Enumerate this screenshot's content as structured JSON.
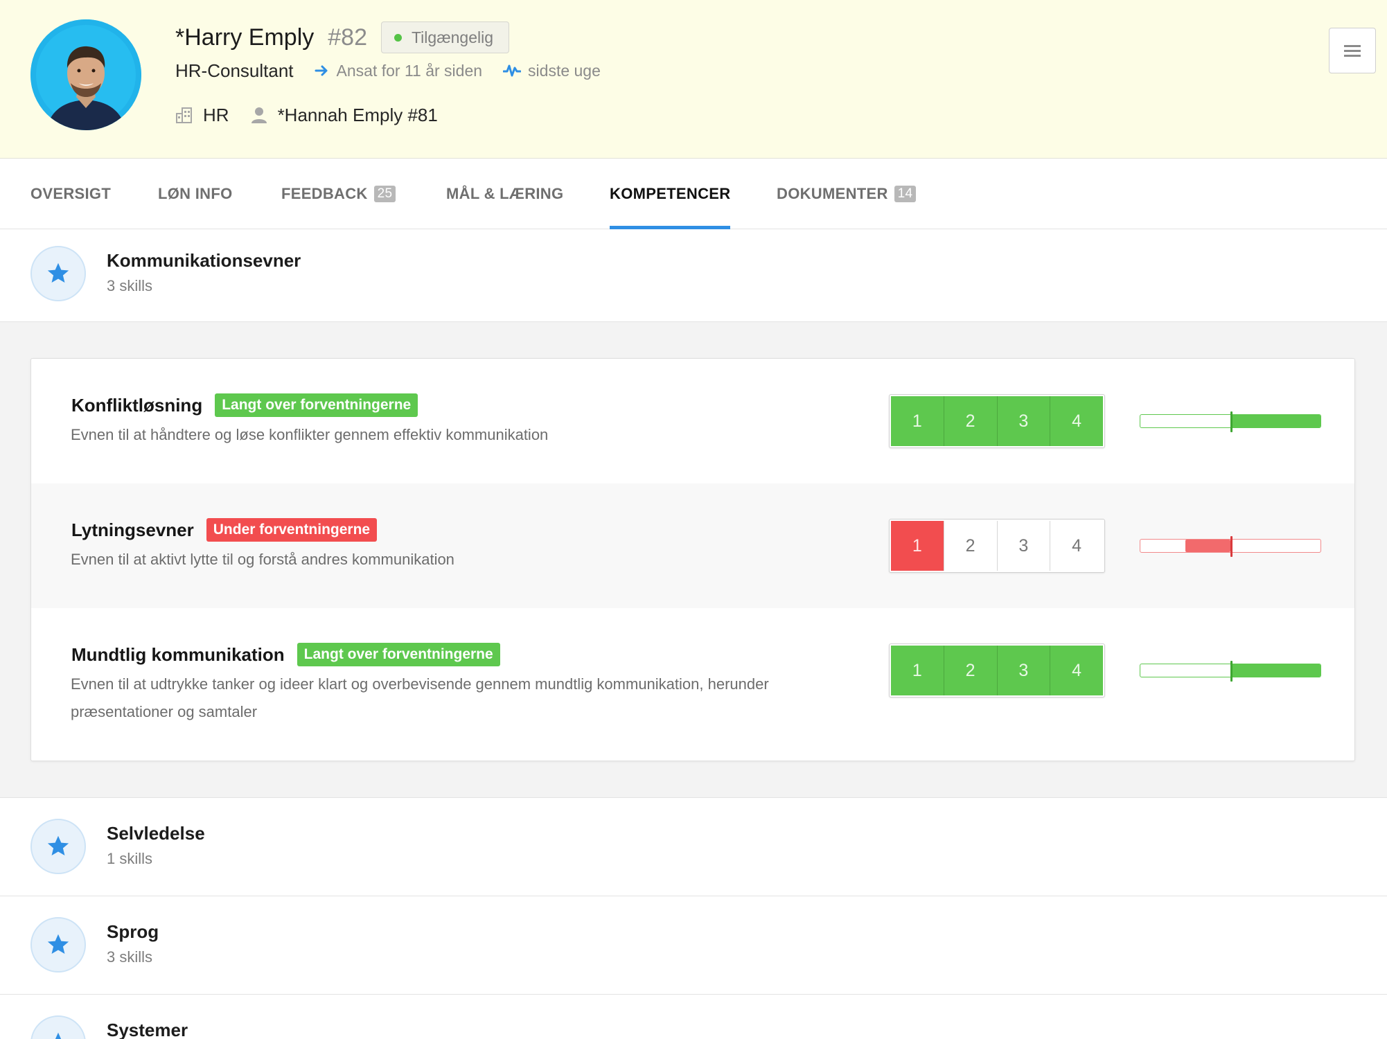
{
  "employee": {
    "name": "*Harry Emply",
    "number": "#82",
    "status": "Tilgængelig",
    "job_title": "HR-Consultant",
    "employed": "Ansat for 11 år siden",
    "activity": "sidste uge",
    "department": "HR",
    "manager": "*Hannah Emply #81"
  },
  "tabs": [
    {
      "label": "OVERSIGT"
    },
    {
      "label": "LØN INFO"
    },
    {
      "label": "FEEDBACK",
      "count": "25"
    },
    {
      "label": "MÅL & LÆRING"
    },
    {
      "label": "KOMPETENCER"
    },
    {
      "label": "DOKUMENTER",
      "count": "14"
    }
  ],
  "active_tab": "KOMPETENCER",
  "categories": [
    {
      "title": "Kommunikationsevner",
      "count": "3 skills",
      "expanded": true,
      "skills": [
        {
          "name": "Konfliktløsning",
          "badge": "Langt over forventningerne",
          "status": "green",
          "desc": "Evnen til at håndtere og løse konflikter gennem effektiv kommunikation",
          "level": 4,
          "scale": [
            "1",
            "2",
            "3",
            "4"
          ],
          "expected_level": 2
        },
        {
          "name": "Lytningsevner",
          "badge": "Under forventningerne",
          "status": "red",
          "desc": "Evnen til at aktivt lytte til og forstå andres kommunikation",
          "level": 1,
          "scale": [
            "1",
            "2",
            "3",
            "4"
          ],
          "expected_level": 2
        },
        {
          "name": "Mundtlig kommunikation",
          "badge": "Langt over forventningerne",
          "status": "green",
          "desc": "Evnen til at udtrykke tanker og ideer klart og overbevisende gennem mundtlig kommunikation, herunder præsentationer og samtaler",
          "level": 4,
          "scale": [
            "1",
            "2",
            "3",
            "4"
          ],
          "expected_level": 2
        }
      ]
    },
    {
      "title": "Selvledelse",
      "count": "1 skills",
      "expanded": false
    },
    {
      "title": "Sprog",
      "count": "3 skills",
      "expanded": false
    },
    {
      "title": "Systemer",
      "count": "",
      "expanded": false
    }
  ],
  "colors": {
    "header_bg": "#fdfde6",
    "accent": "#2f8fe4",
    "status_green": "#5ec84e",
    "status_red": "#f24d4f",
    "available_dot": "#55c346"
  },
  "icons": {
    "employed": "arrow-right-icon",
    "activity": "pulse-icon",
    "department": "building-icon",
    "manager": "person-icon",
    "menu": "hamburger-menu-icon",
    "category": "star-icon"
  }
}
